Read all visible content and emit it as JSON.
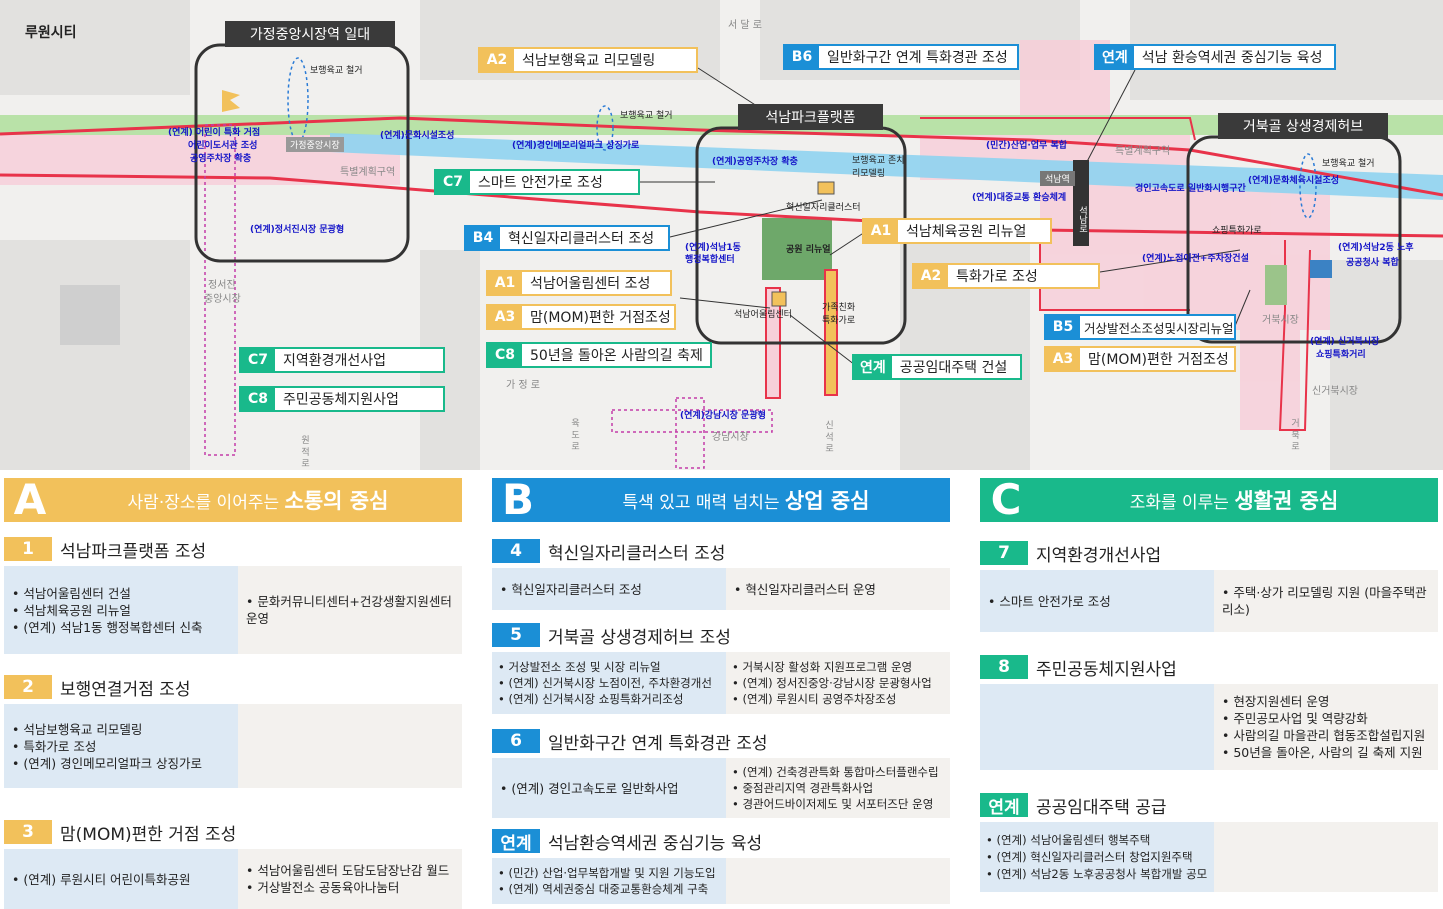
{
  "map": {
    "city_label": "루원시티",
    "zone_titles": {
      "gajeong": "가정중앙시장역 일대",
      "seoknam": "석남파크플랫폼",
      "geobuk": "거북골 상생경제허브"
    },
    "tags": {
      "a2_bridge": {
        "code": "A2",
        "text": "석남보행육교 리모델링"
      },
      "b6": {
        "code": "B6",
        "text": "일반화구간 연계 특화경관 조성"
      },
      "link_station": {
        "code": "연계",
        "text": "석남 환승역세권 중심기능 육성"
      },
      "c7_smart": {
        "code": "C7",
        "text": "스마트 안전가로 조성"
      },
      "b4": {
        "code": "B4",
        "text": "혁신일자리클러스터 조성"
      },
      "a1_park": {
        "code": "A1",
        "text": "석남체육공원 리뉴얼"
      },
      "a1_center": {
        "code": "A1",
        "text": "석남어울림센터 조성"
      },
      "a2_street": {
        "code": "A2",
        "text": "특화가로 조성"
      },
      "a3_mom_left": {
        "code": "A3",
        "text": "맘(MOM)편한 거점조성"
      },
      "b5": {
        "code": "B5",
        "text": "거상발전소조성및시장리뉴얼"
      },
      "c8_festival": {
        "code": "C8",
        "text": "50년을 돌아온 사람의길 축제"
      },
      "link_housing": {
        "code": "연계",
        "text": "공공임대주택 건설"
      },
      "a3_mom_right": {
        "code": "A3",
        "text": "맘(MOM)편한 거점조성"
      },
      "c7_env": {
        "code": "C7",
        "text": "지역환경개선사업"
      },
      "c8_community": {
        "code": "C8",
        "text": "주민공동체지원사업"
      }
    },
    "labels": {
      "seodal_ro": "서 달 로",
      "bridge1": "보행육교 철거",
      "bridge2": "보행육교 철거",
      "bridge3": "보행육교 철거",
      "kids_street": "(연계) 어린이 특화 거점",
      "kids_library": "어린이도서관 조성",
      "public_parking": "공영주차장 확충",
      "gajeong_station": "가정중앙시장",
      "culture_left": "(연계)문화시설조성",
      "memorial_park": "(연계)경인메모리얼파크 상징가로",
      "special_plan_left": "특별계획구역",
      "parking_expand": "(연계)공영주차장 확충",
      "bridge_keep": "보행육교 존치",
      "remodel": "리모델링",
      "private_complex": "(민간)산업·업무 복합",
      "special_plan_right": "특별계획구역",
      "seoknam_station": "석남역",
      "transit_hub": "(연계)대중교통 환승체계",
      "seoknam_ro": "석남로",
      "culture_right": "(연계)문화체육시설조성",
      "highway_general": "경인고속도로 일반화시행구간",
      "seojin_tour": "(연계)정서진시장 문광형",
      "innovation_cluster": "혁신일자리클러스터",
      "admin_center_1": "(연계)석남1동",
      "admin_center_2": "행정복합센터",
      "park_renewal": "공원 리뉴얼",
      "family_street_1": "가족친화",
      "family_street_2": "특화가로",
      "oullim_center": "석남어울림센터",
      "shopping_street": "쇼핑특화가로",
      "street_vendor": "(연계)노점이전+주차장건설",
      "seoknam2_1": "(연계)석남2동 노후",
      "seoknam2_2": "공공청사 복합",
      "geobuk_market": "거북시장",
      "new_geobuk_1": "(연계) 신거북시장",
      "new_geobuk_2": "쇼핑특화거리",
      "new_geobuk_market": "신거북시장",
      "jeongseojin_1": "정서진",
      "jeongseojin_2": "중앙시장",
      "gajeong_ro": "가 정 로",
      "gangnam_tour": "(연계)강남시장 문광형",
      "gangnam_market": "강남시장",
      "wonjeok_ro": "원 적 로",
      "yugdo_ro": "육 도 로",
      "sinseok_ro": "신 석 로",
      "geobuk_ro": "거 북 로"
    }
  },
  "sections": {
    "A": {
      "letter": "A",
      "head_pre": "사람·장소를 이어주는 ",
      "head_strong": "소통의 중심",
      "items": [
        {
          "num": "1",
          "name": "석남파크플랫폼 조성",
          "left": [
            "석남어울림센터 건설",
            "석남체육공원 리뉴얼",
            "(연계) 석남1동 행정복합센터 신축"
          ],
          "right": [
            "문화커뮤니티센터+건강생활지원센터 운영"
          ]
        },
        {
          "num": "2",
          "name": "보행연결거점 조성",
          "left": [
            "석남보행육교 리모델링",
            "특화가로 조성",
            "(연계) 경인메모리얼파크 상징가로"
          ],
          "right": []
        },
        {
          "num": "3",
          "name": "맘(MOM)편한 거점 조성",
          "left": [
            "(연계) 루원시티 어린이특화공원"
          ],
          "right": [
            "석남어울림센터 도담도담장난감 월드",
            "거상발전소 공동육아나눔터"
          ]
        }
      ]
    },
    "B": {
      "letter": "B",
      "head_pre": "특색 있고 매력 넘치는 ",
      "head_strong": "상업 중심",
      "items": [
        {
          "num": "4",
          "name": "혁신일자리클러스터 조성",
          "left": [
            "혁신일자리클러스터 조성"
          ],
          "right": [
            "혁신일자리클러스터 운영"
          ]
        },
        {
          "num": "5",
          "name": "거북골 상생경제허브 조성",
          "left": [
            "거상발전소 조성 및 시장 리뉴얼",
            "(연계) 신거북시장 노점이전, 주차환경개선",
            "(연계) 신거북시장 쇼핑특화거리조성"
          ],
          "right": [
            "거북시장 활성화 지원프로그램 운영",
            "(연계) 정서진중앙·강남시장 문광형사업",
            "(연계) 루원시티 공영주차장조성"
          ]
        },
        {
          "num": "6",
          "name": "일반화구간 연계 특화경관 조성",
          "left": [
            "(연계) 경인고속도로 일반화사업"
          ],
          "right": [
            "(연계) 건축경관특화 통합마스터플랜수립",
            "중점관리지역 경관특화사업",
            "경관어드바이저제도 및 서포터즈단 운영"
          ]
        },
        {
          "num": "연계",
          "name": "석남환승역세권 중심기능 육성",
          "left": [
            "(민간) 산업·업무복합개발 및 지원 기능도입",
            "(연계) 역세권중심 대중교통환승체계 구축"
          ],
          "right": []
        }
      ]
    },
    "C": {
      "letter": "C",
      "head_pre": "조화를 이루는 ",
      "head_strong": "생활권 중심",
      "items": [
        {
          "num": "7",
          "name": "지역환경개선사업",
          "left": [
            "스마트 안전가로 조성"
          ],
          "right": [
            "주택·상가 리모델링 지원 (마을주택관리소)"
          ]
        },
        {
          "num": "8",
          "name": "주민공동체지원사업",
          "left": [],
          "right": [
            "현장지원센터 운영",
            "주민공모사업 및 역량강화",
            "사람의길 마을관리 협동조합설립지원",
            "50년을 돌아온, 사람의 길 축제 지원"
          ]
        },
        {
          "num": "연계",
          "name": "공공임대주택 공급",
          "left": [
            "(연계) 석남어울림센터 행복주택",
            "(연계) 혁신일자리클러스터 창업지원주택",
            "(연계) 석남2동 노후공공청사 복합개발 공모"
          ],
          "right": []
        }
      ]
    }
  },
  "colors": {
    "A": "#f2c15b",
    "B": "#1b8fd6",
    "C": "#19b98b",
    "zone_border": "#333333",
    "plan_outline": "#e8334a",
    "rail": "#8fd3f0"
  }
}
